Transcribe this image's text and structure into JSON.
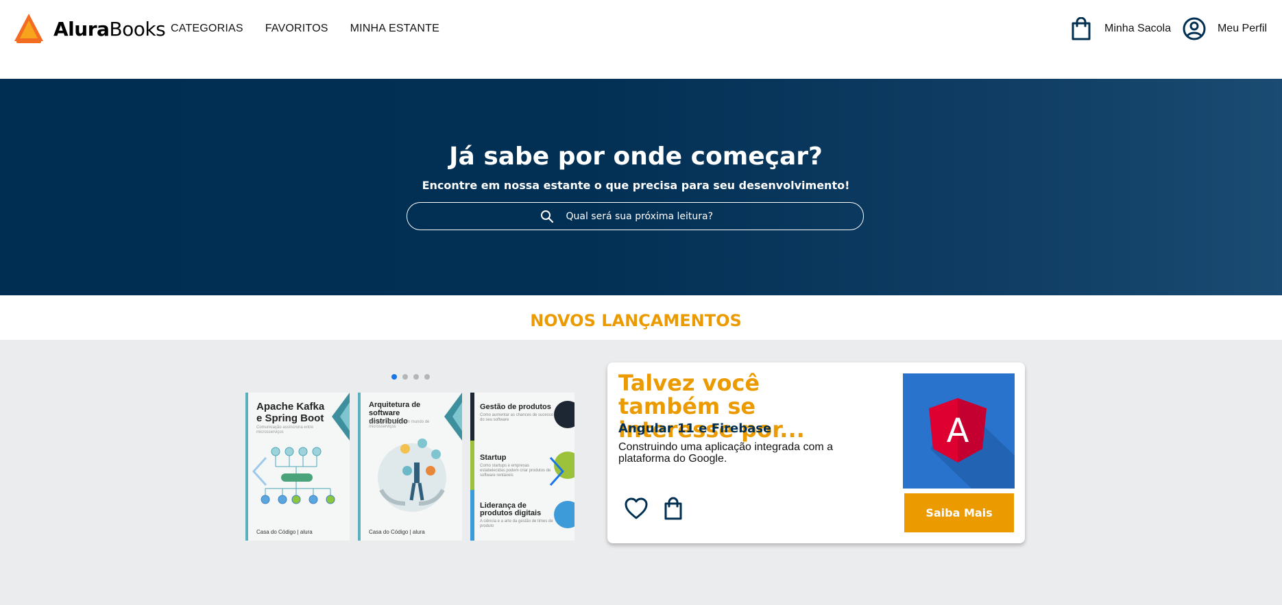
{
  "header": {
    "logo_bold": "Alura",
    "logo_light": "Books",
    "nav": [
      "CATEGORIAS",
      "FAVORITOS",
      "MINHA ESTANTE"
    ],
    "bag_label": "Minha Sacola",
    "profile_label": "Meu Perfil"
  },
  "hero": {
    "title": "Já sabe por onde começar?",
    "subtitle": "Encontre em nossa estante o que precisa para seu desenvolvimento!",
    "search_placeholder": "Qual será sua próxima leitura?"
  },
  "launches": {
    "title": "NOVOS LANÇAMENTOS",
    "carousel": {
      "dot_count": 4,
      "active_dot": 0,
      "books": [
        {
          "title": "Apache Kafka e Spring Boot",
          "subtitle": "Comunicação assíncrona entre microsserviços",
          "brand": "Casa do Código | alura"
        },
        {
          "title": "Arquitetura de software distribuído",
          "subtitle": "Boas práticas para um mundo de microsserviços",
          "brand": "Casa do Código | alura"
        },
        {
          "sections": [
            {
              "h": "Gestão de produtos",
              "d": "Como aumentar as chances de sucesso do seu software"
            },
            {
              "h": "Startup",
              "d": "Como startups e empresas estabelecidas podem criar produtos de software rentáveis"
            },
            {
              "h": "Liderança de produtos digitais",
              "d": "A ciência e a arte da gestão de times de produto"
            }
          ]
        }
      ]
    }
  },
  "recommendation": {
    "heading": "Talvez você também se interesse por...",
    "book_title": "Angular 11 e Firebase",
    "description": "Construindo uma aplicação integrada com a plataforma do Google.",
    "cover_letter": "A",
    "button_label": "Saiba Mais"
  },
  "colors": {
    "primary_dark": "#002f52",
    "accent": "#eb9b00",
    "dot_active": "#1875e8"
  },
  "icons": [
    "logo-icon",
    "bag-icon",
    "profile-icon",
    "search-icon",
    "chevron-left-icon",
    "chevron-right-icon",
    "heart-icon",
    "shopping-bag-icon"
  ]
}
